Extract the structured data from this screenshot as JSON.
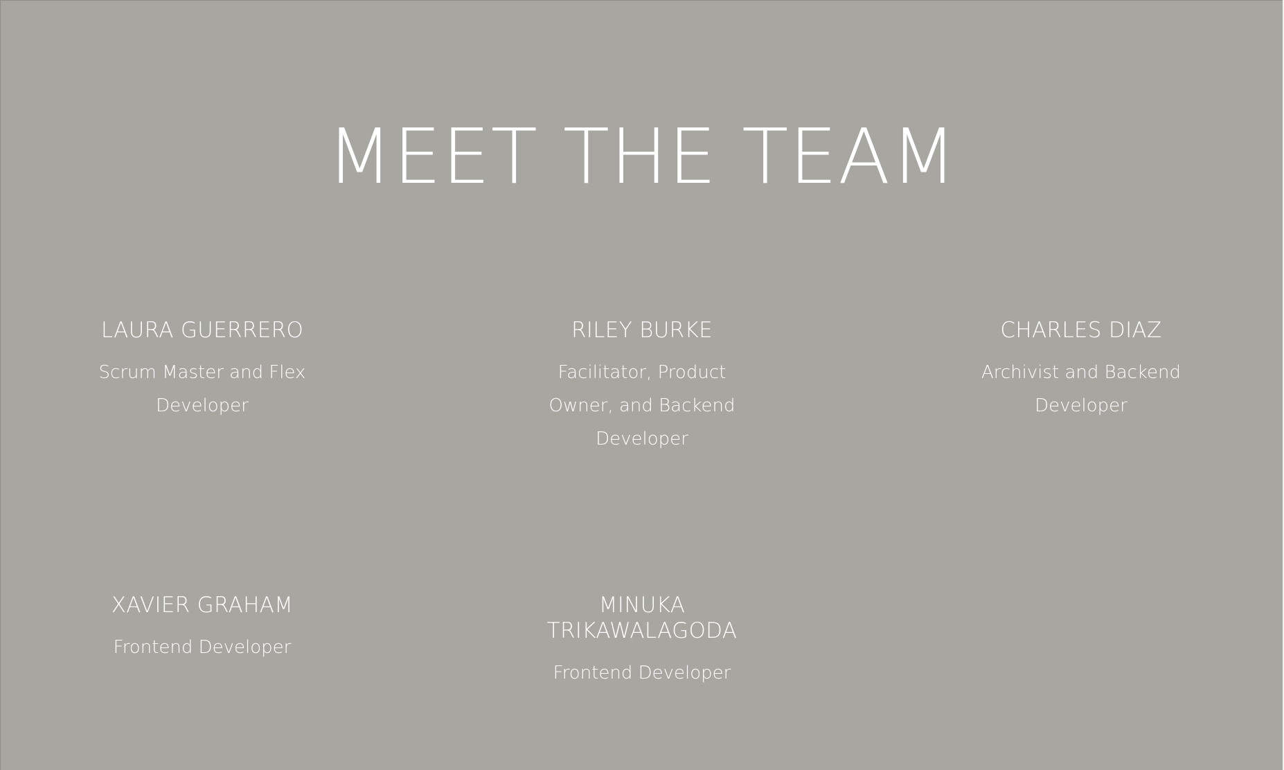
{
  "section": {
    "title": "MEET THE TEAM"
  },
  "team": {
    "members": [
      {
        "name": "LAURA GUERRERO",
        "role": "Scrum Master and Flex Developer"
      },
      {
        "name": "RILEY BURKE",
        "role": "Facilitator, Product Owner, and Backend Developer"
      },
      {
        "name": "CHARLES DIAZ",
        "role": "Archivist and Backend Developer"
      },
      {
        "name": "XAVIER GRAHAM",
        "role": "Frontend Developer"
      },
      {
        "name": "MINUKA TRIKAWALAGODA",
        "role": "Frontend Developer"
      }
    ]
  },
  "colors": {
    "background": "#a7a6a1",
    "text": "#ffffff"
  }
}
